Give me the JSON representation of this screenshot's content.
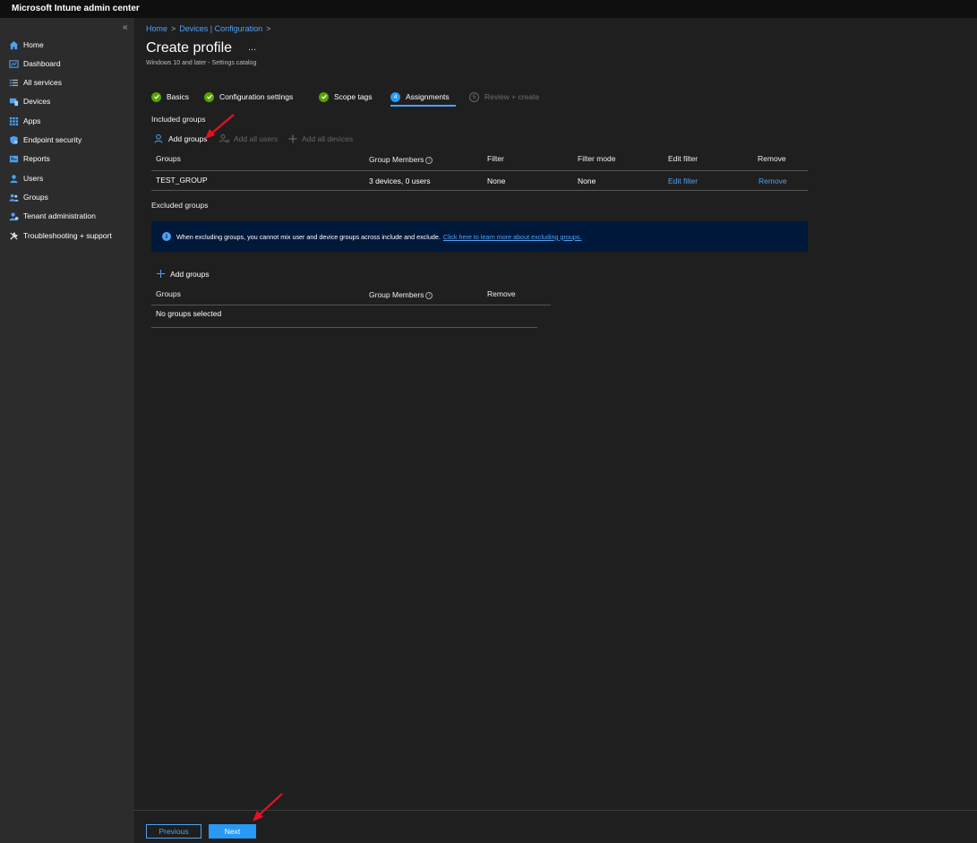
{
  "app": {
    "title": "Microsoft Intune admin center"
  },
  "sidebar": {
    "collapse_glyph": "«",
    "items": [
      {
        "label": "Home",
        "icon": "home-icon"
      },
      {
        "label": "Dashboard",
        "icon": "dashboard-icon"
      },
      {
        "label": "All services",
        "icon": "list-icon"
      },
      {
        "label": "Devices",
        "icon": "devices-icon"
      },
      {
        "label": "Apps",
        "icon": "apps-grid-icon"
      },
      {
        "label": "Endpoint security",
        "icon": "shield-icon"
      },
      {
        "label": "Reports",
        "icon": "reports-icon"
      },
      {
        "label": "Users",
        "icon": "user-icon"
      },
      {
        "label": "Groups",
        "icon": "groups-icon"
      },
      {
        "label": "Tenant administration",
        "icon": "tenant-admin-icon"
      },
      {
        "label": "Troubleshooting + support",
        "icon": "wrench-icon"
      }
    ]
  },
  "breadcrumb": {
    "home": "Home",
    "devices": "Devices | Configuration",
    "sep": ">"
  },
  "page": {
    "title": "Create profile",
    "ellipsis": "...",
    "subtitle": "Windows 10 and later - Settings catalog"
  },
  "steps": [
    {
      "label": "Basics",
      "state": "complete"
    },
    {
      "label": "Configuration settings",
      "state": "complete"
    },
    {
      "label": "Scope tags",
      "state": "complete"
    },
    {
      "label": "Assignments",
      "state": "active",
      "number": "4"
    },
    {
      "label": "Review + create",
      "state": "pending",
      "number": "5"
    }
  ],
  "included": {
    "heading": "Included groups",
    "commands": {
      "add_groups": "Add groups",
      "add_all_users": "Add all users",
      "add_all_devices": "Add all devices"
    },
    "columns": {
      "groups": "Groups",
      "group_members": "Group Members",
      "filter": "Filter",
      "filter_mode": "Filter mode",
      "edit_filter": "Edit filter",
      "remove": "Remove"
    },
    "rows": [
      {
        "group": "TEST_GROUP",
        "members": "3 devices, 0 users",
        "filter": "None",
        "filter_mode": "None",
        "edit_filter": "Edit filter",
        "remove": "Remove"
      }
    ]
  },
  "excluded": {
    "heading": "Excluded groups",
    "info_text": "When excluding groups, you cannot mix user and device groups across include and exclude.",
    "info_link": "Click here to learn more about excluding groups.",
    "add_groups": "Add groups",
    "columns": {
      "groups": "Groups",
      "group_members": "Group Members",
      "remove": "Remove"
    },
    "empty_text": "No groups selected"
  },
  "footer": {
    "previous": "Previous",
    "next": "Next"
  },
  "colors": {
    "accent": "#2899f5",
    "link": "#4ea1f3",
    "success": "#57a300",
    "annotation_arrow": "#e81123",
    "info_bar_bg": "#00183a"
  }
}
